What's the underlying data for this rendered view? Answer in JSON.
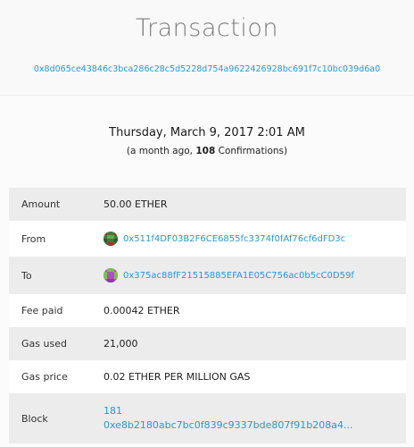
{
  "header": {
    "title": "Transaction",
    "tx_hash": "0x8d065ce43846c3bca286c28c5d5228d754a9622426928bc691f7c10bc039d6a0"
  },
  "summary": {
    "date": "Thursday, March 9, 2017 2:01 AM",
    "confirm_prefix": "(a month ago, ",
    "confirm_count": "108",
    "confirm_suffix": " Confirmations)"
  },
  "details": {
    "amount": {
      "label": "Amount",
      "value": "50.00 ETHER"
    },
    "from": {
      "label": "From",
      "value": "0x511f4DF03B2F6CE6855fc3374f0fAf76cf6dFD3c",
      "icon": "identicon-green"
    },
    "to": {
      "label": "To",
      "value": "0x375ac88fF21515885EFA1E05C756ac0b5cC0D59f",
      "icon": "identicon-purple"
    },
    "fee_paid": {
      "label": "Fee paid",
      "value": "0.00042 ETHER"
    },
    "gas_used": {
      "label": "Gas used",
      "value": "21,000"
    },
    "gas_price": {
      "label": "Gas price",
      "value": "0.02 ETHER PER MILLION GAS"
    },
    "block": {
      "label": "Block",
      "number": "181",
      "hash": "0xe8b2180abc7bc0f839c9337bde807f91b208a4..."
    }
  }
}
